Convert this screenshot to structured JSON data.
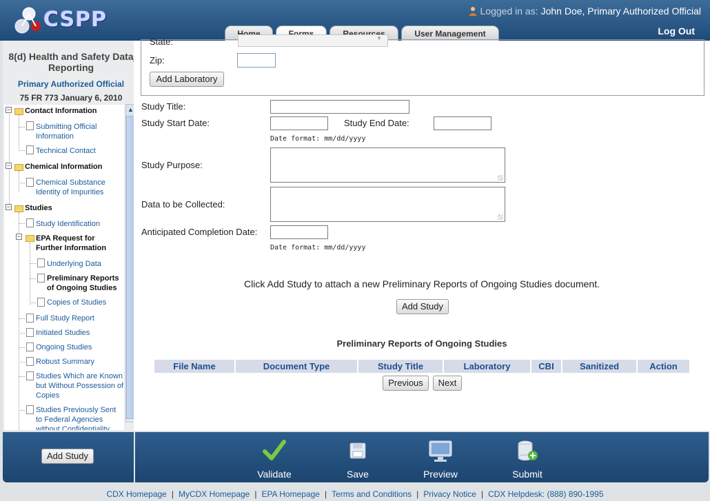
{
  "header": {
    "app_name": "CSPP",
    "logged_in_label": "Logged in as:",
    "user": "John Doe, Primary Authorized Official",
    "tabs": [
      "Home",
      "Forms",
      "Resources",
      "User Management"
    ],
    "active_tab": "Forms",
    "logout": "Log Out"
  },
  "sidebar": {
    "title": "8(d) Health and Safety Data Reporting",
    "role": "Primary Authorized Official",
    "fr_notice": "75 FR 773 January 6, 2010",
    "tree": {
      "contact_info": "Contact Information",
      "submitting_official": "Submitting Official Information",
      "technical_contact": "Technical Contact",
      "chemical_info": "Chemical Information",
      "chemical_substance": "Chemical Substance Identity of Impurities",
      "studies": "Studies",
      "study_identification": "Study Identification",
      "epa_request": "EPA Request for Further Information",
      "underlying_data": "Underlying Data",
      "preliminary_reports": "Preliminary Reports of Ongoing Studies",
      "copies_of_studies": "Copies of Studies",
      "full_study_report": "Full Study Report",
      "initiated_studies": "Initiated Studies",
      "ongoing_studies": "Ongoing Studies",
      "robust_summary": "Robust Summary",
      "studies_known": "Studies Which are Known but Without Possession of Copies",
      "studies_previously_sent": "Studies Previously Sent to Federal Agencies without Confidentiality Claims"
    },
    "add_study_label": "Add Study"
  },
  "form": {
    "state_label": "State:",
    "zip_label": "Zip:",
    "zip_value": "",
    "add_laboratory": "Add Laboratory",
    "study_title_label": "Study Title:",
    "study_title_value": "",
    "study_start_label": "Study Start Date:",
    "study_end_label": "Study End Date:",
    "date_format_hint": "Date format: mm/dd/yyyy",
    "study_purpose_label": "Study Purpose:",
    "data_collected_label": "Data to be Collected:",
    "anticipated_label": "Anticipated Completion Date:",
    "instruction": "Click Add Study to attach a new Preliminary Reports of Ongoing Studies document.",
    "add_study": "Add Study"
  },
  "table": {
    "title": "Preliminary Reports of Ongoing Studies",
    "columns": [
      "File Name",
      "Document Type",
      "Study Title",
      "Laboratory",
      "CBI",
      "Sanitized",
      "Action"
    ],
    "previous": "Previous",
    "next": "Next"
  },
  "actions": {
    "validate": "Validate",
    "save": "Save",
    "preview": "Preview",
    "submit": "Submit"
  },
  "footer": {
    "links": [
      "CDX Homepage",
      "MyCDX Homepage",
      "EPA Homepage",
      "Terms and Conditions",
      "Privacy Notice",
      "CDX Helpdesk: (888) 890-1995"
    ]
  },
  "colors": {
    "header_blue": "#1e4a79",
    "link_blue": "#1c5a9b",
    "table_header_bg": "#d7dbe8"
  }
}
